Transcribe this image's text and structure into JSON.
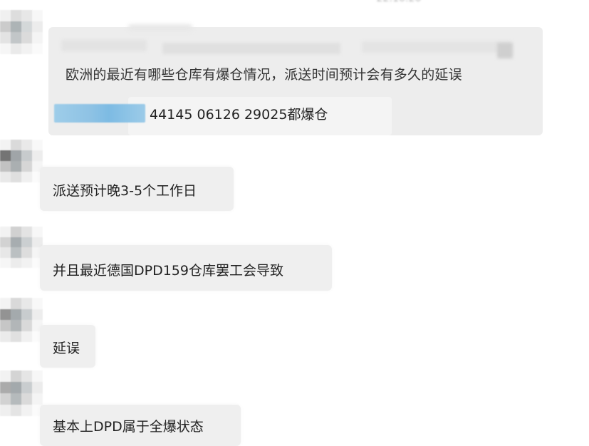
{
  "timestamp_partial": "22:10:20",
  "quoted_message": {
    "question": "欧洲的最近有哪些仓库有爆仓情况，派送时间预计会有多久的延误",
    "tracking_line": "44145 06126  29025都爆仓"
  },
  "messages": [
    {
      "text": "派送预计晚3-5个工作日"
    },
    {
      "text": "并且最近德国DPD159仓库罢工会导致"
    },
    {
      "text": "延误"
    },
    {
      "text": "基本上DPD属于全爆状态"
    }
  ]
}
